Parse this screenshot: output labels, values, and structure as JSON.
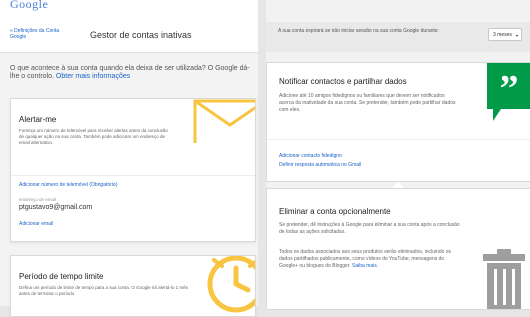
{
  "header": {
    "logo_text": "Google",
    "settings_link": "« Definições da Conta Google",
    "page_title": "Gestor de contas inativas"
  },
  "intro": {
    "text": "O que acontece à sua conta quando ela deixa de ser utilizada? O Google dá-lhe o controlo. ",
    "link": "Obter mais informações"
  },
  "alert_card": {
    "title": "Alertar-me",
    "description": "Forneça um número de telemóvel para receber alertas antes da conclusão de qualquer ação na sua conta. Também pode adicionar um endereço de email alternativo.",
    "add_phone_link": "Adicionar número de telemóvel (Obrigatório)",
    "email_label": "endereço de email",
    "email_value": "ptgustavo9@gmail.com",
    "add_email_link": "Adicionar email"
  },
  "period_card": {
    "title": "Período de tempo limite",
    "description": "Defina um período de limite de tempo para a sua conta. O Google irá alertá-lo 1 mês antes de terminar o período"
  },
  "timeout": {
    "info_text": "A sua conta expirará se não iniciar sessão na sua conta Google durante:",
    "selected_option": "3 meses"
  },
  "notify_card": {
    "title": "Notificar contactos e partilhar dados",
    "description": "Adicione até 10 amigos fidedignos ou familiares que devem ser notificados acerca da inatividade da sua conta. Se pretender, também pode partilhar dados com eles.",
    "add_contact_link": "Adicionar contacto fidedigno",
    "auto_reply_link": "Definir resposta automática no Gmail"
  },
  "delete_card": {
    "title": "Eliminar a conta opcionalmente",
    "description1": "Se pretender, dê instruções à Google para eliminar a sua conta após a conclusão de todas as ações solicitadas.",
    "description2": "Todos os dados associados aos seus produtos serão eliminados, incluindo os dados partilhados publicamente, como vídeos do YouTube, mensagens do Google+ ou blogues do Blogger. ",
    "learn_more_link": "Saiba mais."
  },
  "colors": {
    "accent": "#f8c542",
    "link": "#1a62c7",
    "green_icon": "#009a48",
    "trash": "#9e9e9e"
  },
  "icons": [
    "envelope-icon",
    "clock-icon",
    "quote-icon",
    "trash-icon",
    "dropdown-arrow-icon"
  ]
}
